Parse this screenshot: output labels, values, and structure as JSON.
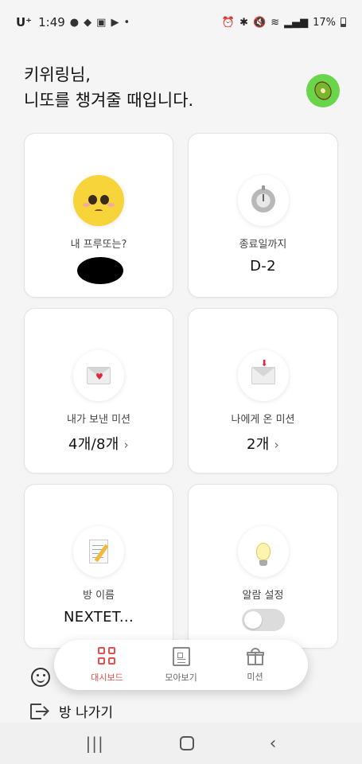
{
  "status_bar": {
    "carrier": "U⁺",
    "time": "1:49",
    "battery": "17%"
  },
  "greeting": {
    "line1": "키위링님,",
    "line2": "니또를 챙겨줄 때입니다."
  },
  "cards": {
    "profile": {
      "label": "내 프루또는?"
    },
    "deadline": {
      "label": "종료일까지",
      "value": "D-2"
    },
    "sent_missions": {
      "label": "내가 보낸 미션",
      "value": "4개/8개"
    },
    "received_missions": {
      "label": "나에게 온 미션",
      "value": "2개"
    },
    "room_name": {
      "label": "방 이름",
      "value": "NEXTET..."
    },
    "alarm": {
      "label": "알람 설정",
      "enabled": false
    }
  },
  "chevron": "›",
  "leave_room": {
    "label": "방 나가기"
  },
  "tabbar": {
    "tabs": [
      {
        "label": "대시보드",
        "active": true
      },
      {
        "label": "모아보기",
        "active": false
      },
      {
        "label": "미션",
        "active": false
      }
    ]
  },
  "android_nav": {
    "recent": "|||",
    "back": "‹"
  },
  "colors": {
    "accent": "#e55050",
    "avatar_bg": "#6ad54a",
    "background": "#f5f5f5"
  }
}
